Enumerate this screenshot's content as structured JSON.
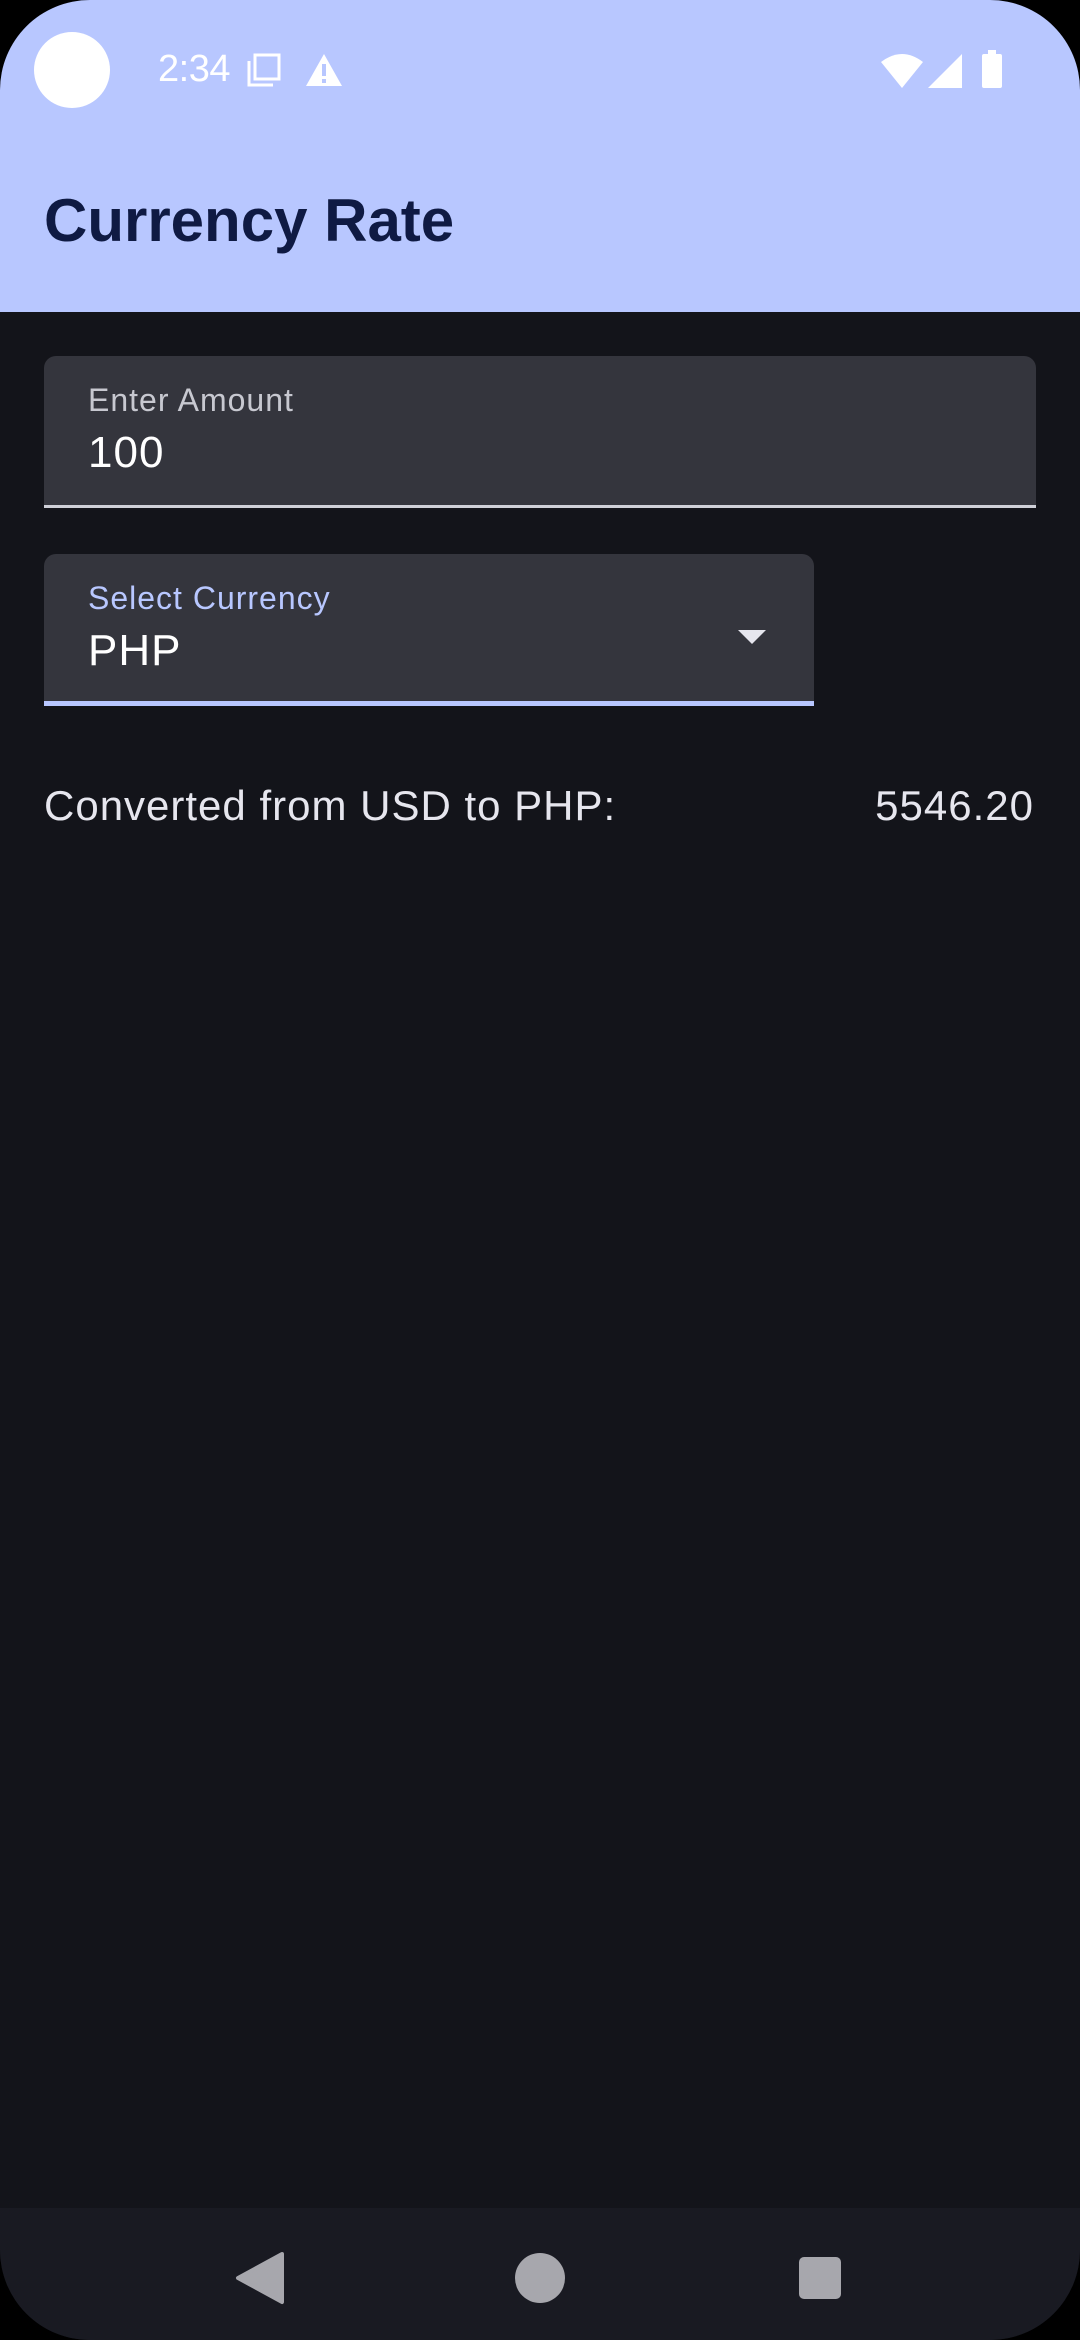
{
  "status_bar": {
    "time": "2:34",
    "icons": [
      "camera-cutout",
      "screenshot-icon",
      "warning-icon",
      "wifi-icon",
      "signal-icon",
      "battery-icon"
    ]
  },
  "app_bar": {
    "title": "Currency Rate"
  },
  "amount_field": {
    "label": "Enter Amount",
    "value": "100"
  },
  "currency_field": {
    "label": "Select Currency",
    "value": "PHP",
    "icon": "dropdown-arrow-icon"
  },
  "result": {
    "label": "Converted from USD to PHP:",
    "value": "5546.20"
  },
  "nav_bar": {
    "buttons": [
      "back-icon",
      "home-icon",
      "recents-icon"
    ]
  },
  "colors": {
    "app_bar_bg": "#b8c7ff",
    "background": "#13141a",
    "field_bg": "#34353d",
    "accent": "#b8c7ff",
    "title_text": "#0f1a43"
  }
}
